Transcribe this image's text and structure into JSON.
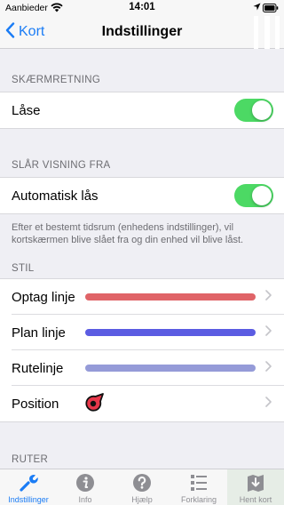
{
  "status": {
    "carrier": "Aanbieder",
    "time": "14:01"
  },
  "nav": {
    "back_label": "Kort",
    "title": "Indstillinger"
  },
  "sections": {
    "screen_orientation": {
      "header": "SKÆRMRETNING",
      "row_label": "Låse",
      "toggle_on": true
    },
    "turn_off_display": {
      "header": "SLÅR VISNING FRA",
      "row_label": "Automatisk lås",
      "toggle_on": true,
      "footer": "Efter et bestemt tidsrum (enhedens indstillinger), vil kortskærmen blive slået fra og din enhed vil blive låst."
    },
    "style": {
      "header": "STIL",
      "rows": [
        {
          "label": "Optag linje",
          "color": "#e06468"
        },
        {
          "label": "Plan linje",
          "color": "#5b5ce2"
        },
        {
          "label": "Rutelinje",
          "color": "#959bd8"
        },
        {
          "label": "Position",
          "icon": "position-marker-icon"
        }
      ]
    },
    "routes": {
      "header": "RUTER"
    }
  },
  "tabs": [
    {
      "label": "Indstillinger",
      "icon": "wrench-icon",
      "active": true
    },
    {
      "label": "Info",
      "icon": "info-icon",
      "active": false
    },
    {
      "label": "Hjælp",
      "icon": "help-icon",
      "active": false
    },
    {
      "label": "Forklaring",
      "icon": "legend-icon",
      "active": false
    },
    {
      "label": "Hent kort",
      "icon": "download-map-icon",
      "active": false
    }
  ],
  "colors": {
    "accent": "#1a7cf5",
    "toggle_on": "#4cd964"
  }
}
